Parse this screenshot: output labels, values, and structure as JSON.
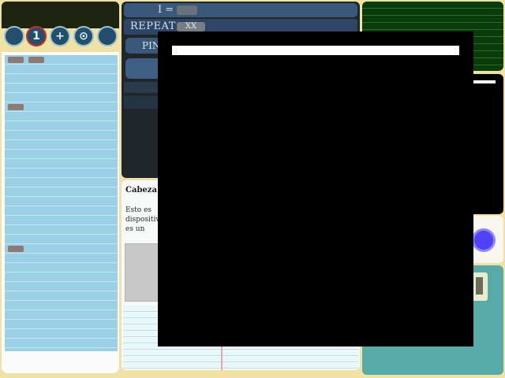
{
  "toolbar": {
    "tools": [
      {
        "name": "tool-button-1",
        "glyph": "",
        "active": false
      },
      {
        "name": "tool-button-2",
        "glyph": "1",
        "active": true
      },
      {
        "name": "tool-button-3",
        "glyph": "+",
        "active": false
      },
      {
        "name": "tool-button-4",
        "glyph": "⊙",
        "active": false
      },
      {
        "name": "tool-button-5",
        "glyph": "",
        "active": false
      }
    ]
  },
  "script": {
    "i_label": "I =",
    "repeat_label": "REPEAT",
    "repeat_value": "XX",
    "pin_label": "PIN"
  },
  "notes": {
    "title": "Cabeza",
    "lines": [
      "Esto es",
      "dispositivo",
      "es un"
    ]
  }
}
